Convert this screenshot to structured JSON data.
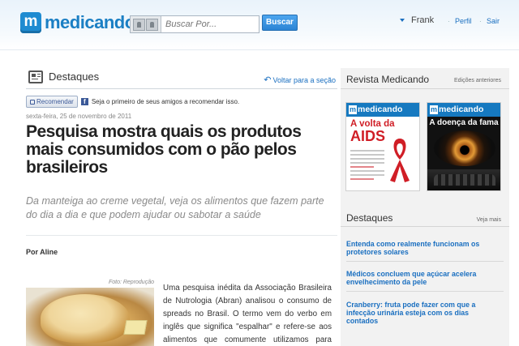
{
  "header": {
    "logo_text": "medicando",
    "logo_mark": "m",
    "search_placeholder": "Buscar Por...",
    "search_button": "Buscar",
    "user_name": "Frank",
    "profile_link": "Perfil",
    "logout_link": "Sair",
    "separator": "·"
  },
  "section": {
    "title": "Destaques",
    "back_link": "Voltar para a seção",
    "back_icon": "curved-arrow-icon"
  },
  "social": {
    "recommend_button": "Recomendar",
    "recommend_text": "Seja o primeiro de seus amigos a recomendar isso.",
    "fb_mark": "f"
  },
  "article": {
    "date": "sexta-feira, 25 de novembro de 2011",
    "title": "Pesquisa mostra quais os produtos mais consumidos com o pão pelos brasileiros",
    "lead": "Da manteiga ao creme vegetal, veja os alimentos que fazem parte do dia a dia e que podem ajudar ou sabotar a saúde",
    "author": "Por Aline",
    "photo_credit": "Foto: Reprodução",
    "body": "Uma pesquisa inédita da Associação Brasileira de Nutrologia (Abran) analisou o consumo de spreads no Brasil. O termo vem do verbo em inglês que significa \"espalhar\" e refere-se aos alimentos que comumente utilizamos para passar em pães. De"
  },
  "sidebar": {
    "magazine_title": "Revista Medicando",
    "magazine_previous": "Edições anteriores",
    "covers": [
      {
        "brand": "medicando",
        "headline_small": "A volta da",
        "headline_big": "AIDS"
      },
      {
        "brand": "medicando",
        "headline": "A doença da fama"
      }
    ],
    "destaques_title": "Destaques",
    "destaques_more": "Veja mais",
    "news": [
      "Entenda como realmente funcionam os protetores solares",
      "Médicos concluem que açúcar acelera envelhecimento da pele",
      "Cranberry: fruta pode fazer com que a infecção urinária esteja com os dias contados"
    ]
  },
  "colors": {
    "brand_blue": "#1b7fc4",
    "link_blue": "#1a6fc0",
    "aids_red": "#d01e26",
    "sidebar_bg": "#f2f2f2"
  }
}
